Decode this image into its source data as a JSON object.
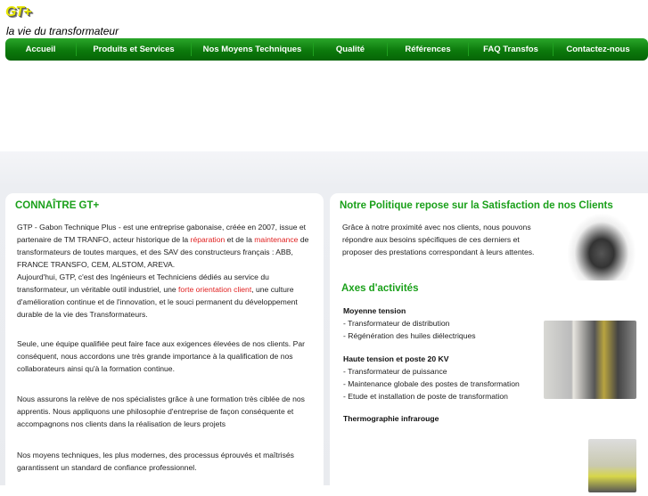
{
  "header": {
    "logo_text": "GT+",
    "tagline": "la vie du transformateur"
  },
  "nav": [
    "Accueil",
    "Produits et Services",
    "Nos Moyens Techniques",
    "Qualité",
    "Références",
    "FAQ Transfos",
    "Contactez-nous"
  ],
  "left": {
    "title": "CONNAÎTRE GT+",
    "p1a": "GTP - Gabon Technique Plus - est une entreprise gabonaise, créée en 2007, issue et partenaire de TM TRANFO, acteur historique de la ",
    "p1_link1": "réparation",
    "p1b": " et de la ",
    "p1_link2": "maintenance",
    "p1c": " de transformateurs de toutes marques, et des SAV des constructeurs français : ABB, FRANCE TRANSFO, CEM, ALSTOM, AREVA.",
    "p2a": "Aujourd'hui, GTP,  c'est des Ingénieurs et Techniciens dédiés au service du transformateur, un véritable outil industriel, une ",
    "p2_link": "forte orientation client",
    "p2b": ", une culture d'amélioration continue et de l'innovation, et le souci permanent du développement durable de la vie des Transformateurs.",
    "p3": "Seule, une équipe qualifiée peut faire face aux exigences élevées de nos clients. Par conséquent, nous accordons une très grande importance à la qualification de nos collaborateurs ainsi qu'à la formation continue.",
    "p4": "Nous assurons la relève de nos spécialistes grâce à une formation très ciblée de nos apprentis. Nous appliquons une philosophie d'entreprise de façon conséquente et accompagnons nos clients dans la réalisation de leurs projets",
    "p5": "Nos moyens techniques, les plus modernes, des processus éprouvés et maîtrisés garantissent un standard de confiance professionnel."
  },
  "right": {
    "title": "Notre Politique repose sur la Satisfaction de nos Clients",
    "intro": "Grâce à notre proximité avec nos clients, nous pouvons répondre aux besoins spécifiques de ces derniers et proposer des prestations correspondant à leurs attentes.",
    "axes_title": "Axes d'activités",
    "groups": [
      {
        "title": "Moyenne tension",
        "items": [
          "- Transformateur de distribution",
          "- Régénération des huiles diélectriques"
        ]
      },
      {
        "title": "Haute tension et poste 20 KV",
        "items": [
          "- Transformateur de puissance",
          "- Maintenance globale des postes de transformation",
          "- Etude et installation de poste de transformation"
        ]
      },
      {
        "title": "Thermographie infrarouge",
        "items": []
      }
    ]
  },
  "colors": {
    "green": "#1aa01a",
    "nav": "#0c7a0c",
    "link": "#e02020"
  }
}
